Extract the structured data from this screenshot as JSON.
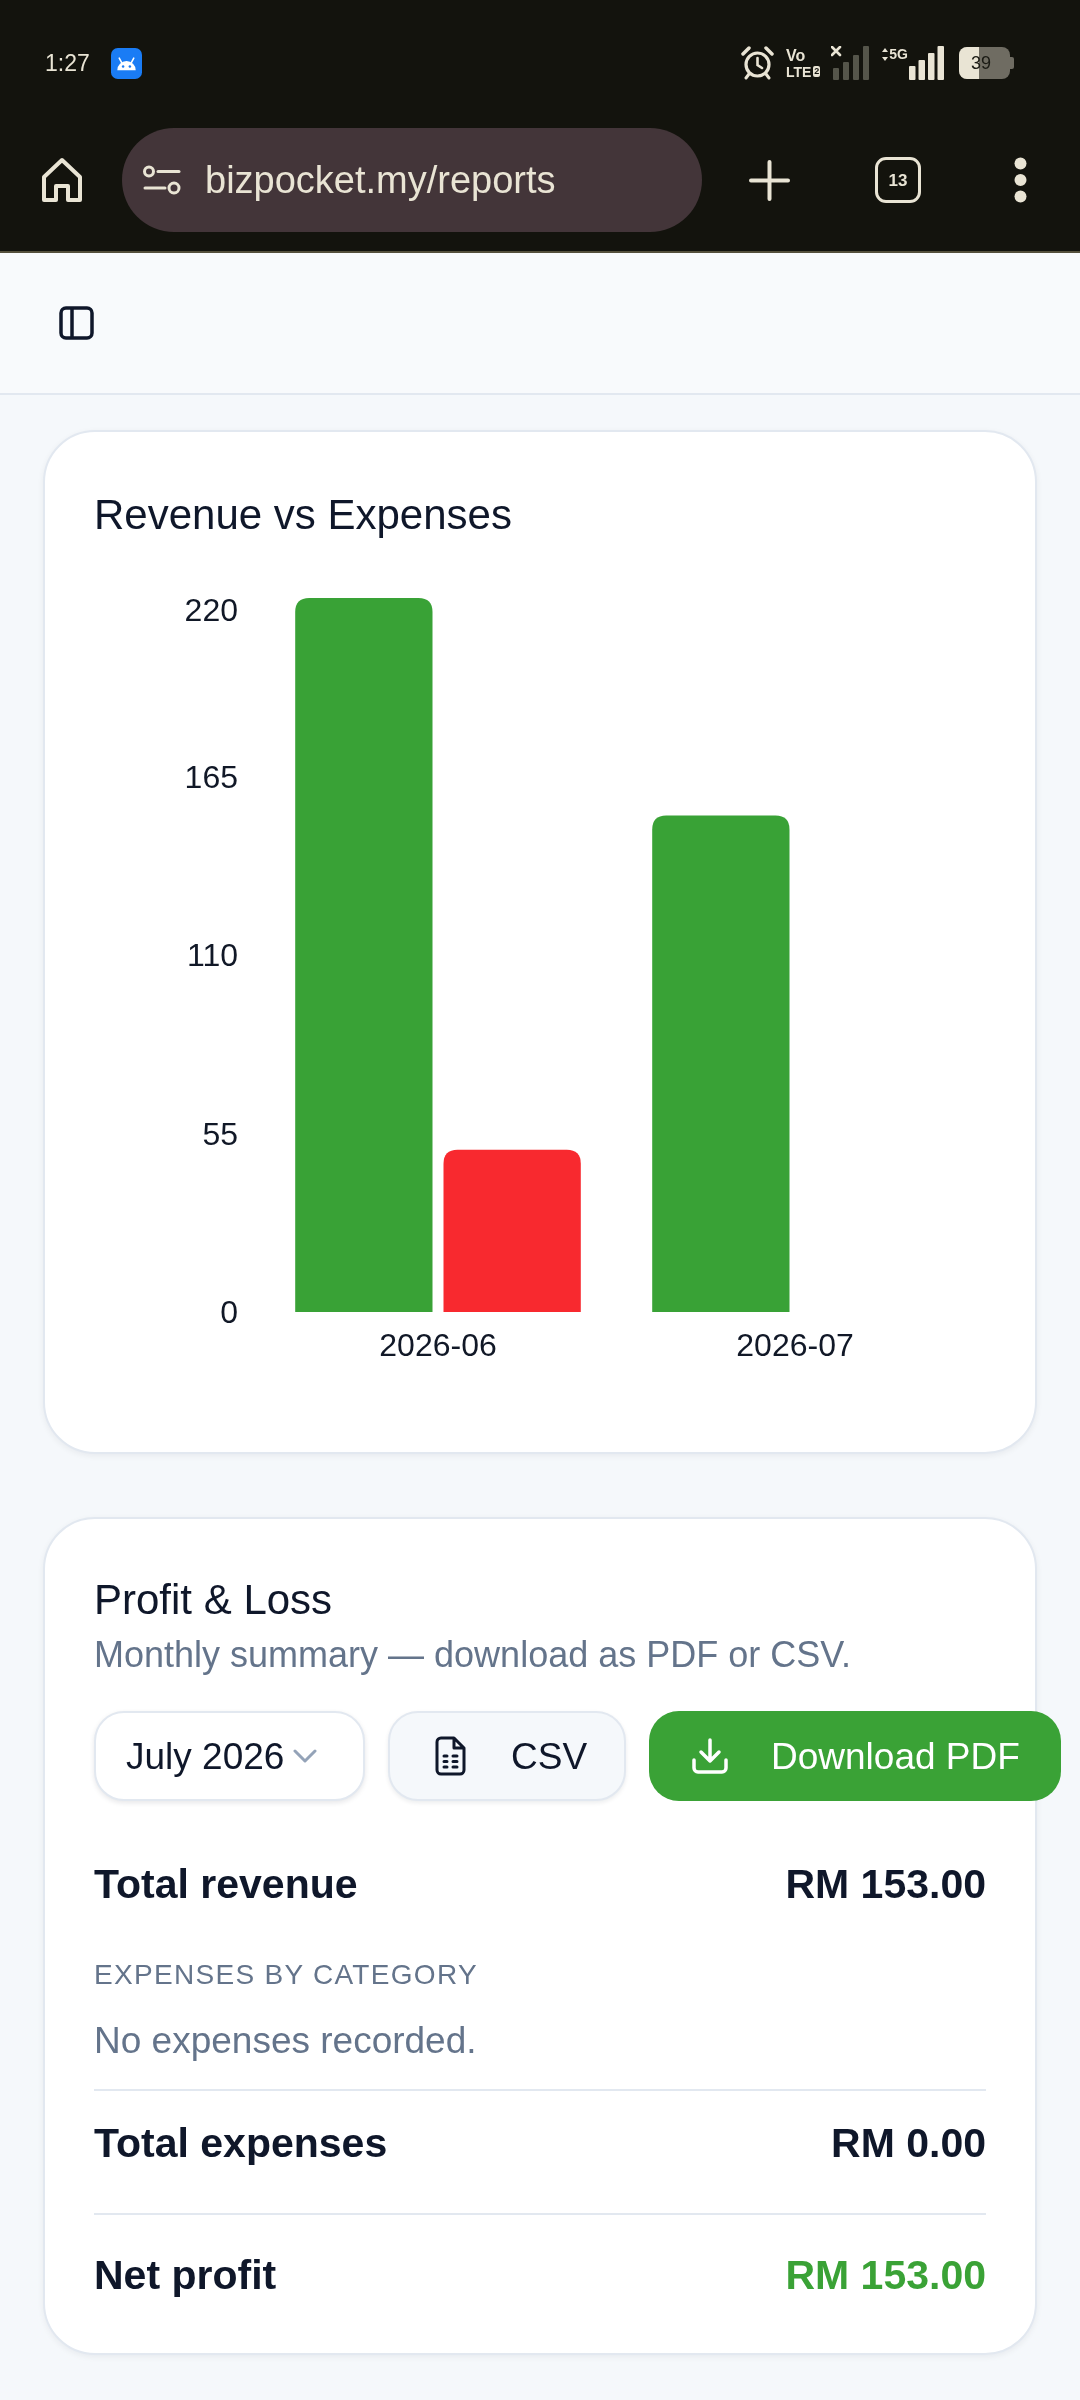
{
  "status_bar": {
    "time": "1:27",
    "volte_top": "Vo",
    "volte_bottom": "LTE",
    "sim_slot": "2",
    "network": "5G",
    "battery": "39"
  },
  "browser": {
    "url": "bizpocket.my/reports",
    "tab_count": "13"
  },
  "revenue_chart": {
    "chart_data": {
      "type": "bar",
      "title": "Revenue vs Expenses",
      "categories": [
        "2026-06",
        "2026-07"
      ],
      "series": [
        {
          "color": "#39a236",
          "values": [
            220,
            153
          ]
        },
        {
          "color": "#f8292f",
          "values": [
            50,
            0
          ]
        }
      ],
      "ylim": [
        0,
        220
      ],
      "yticks": [
        0,
        55,
        110,
        165,
        220
      ]
    }
  },
  "profit_loss": {
    "title": "Profit & Loss",
    "subtitle": "Monthly summary — download as PDF or CSV.",
    "month_select": {
      "value": "July 2026"
    },
    "buttons": [
      {
        "kind": "csv",
        "label": "CSV"
      },
      {
        "kind": "pdf",
        "label": "Download PDF"
      }
    ],
    "total_revenue": {
      "label": "Total revenue",
      "value": "RM 153.00"
    },
    "expenses_by_category": {
      "heading": "EXPENSES BY CATEGORY",
      "empty_text": "No expenses recorded."
    },
    "total_expenses": {
      "label": "Total expenses",
      "value": "RM 0.00"
    },
    "net_profit": {
      "label": "Net profit",
      "value": "RM 153.00",
      "positive": true
    }
  }
}
